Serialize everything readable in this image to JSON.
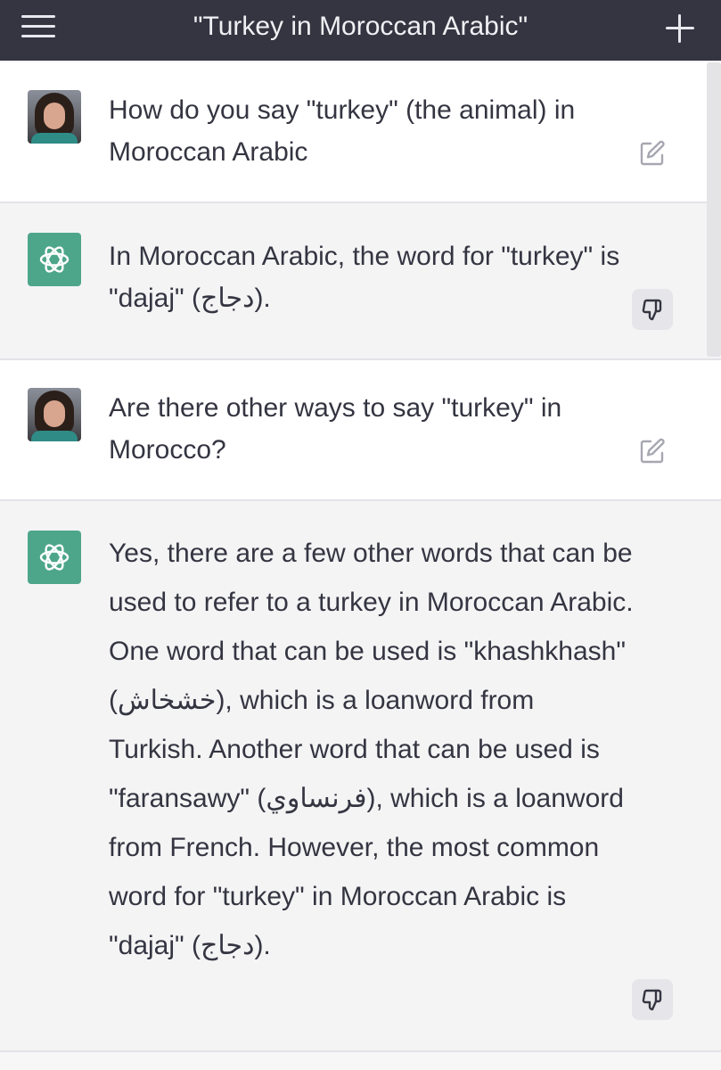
{
  "header": {
    "title": "\"Turkey in Moroccan Arabic\"",
    "menu_icon": "hamburger-menu-icon",
    "new_chat_icon": "plus-icon"
  },
  "messages": [
    {
      "role": "user",
      "text": "How do you say \"turkey\" (the animal) in Moroccan Arabic",
      "action_icon": "edit-icon"
    },
    {
      "role": "assistant",
      "text": "In Moroccan Arabic, the word for \"turkey\" is \"dajaj\" (دجاج).",
      "action_icon": "thumbs-down-icon"
    },
    {
      "role": "user",
      "text": "Are there other ways to say \"turkey\" in Morocco?",
      "action_icon": "edit-icon"
    },
    {
      "role": "assistant",
      "text": "Yes, there are a few other words that can be used to refer to a turkey in Moroccan Arabic. One word that can be used is \"khashkhash\" (خشخاش), which is a loanword from Turkish. Another word that can be used is \"faransawy\" (فرنساوي), which is a loanword from French. However, the most common word for \"turkey\" in Moroccan Arabic is \"dajaj\" (دجاج).",
      "action_icon": "thumbs-down-icon"
    }
  ],
  "colors": {
    "header_bg": "#343541",
    "assistant_bg": "#f4f4f5",
    "user_bg": "#ffffff",
    "bot_avatar": "#4ea68a"
  }
}
